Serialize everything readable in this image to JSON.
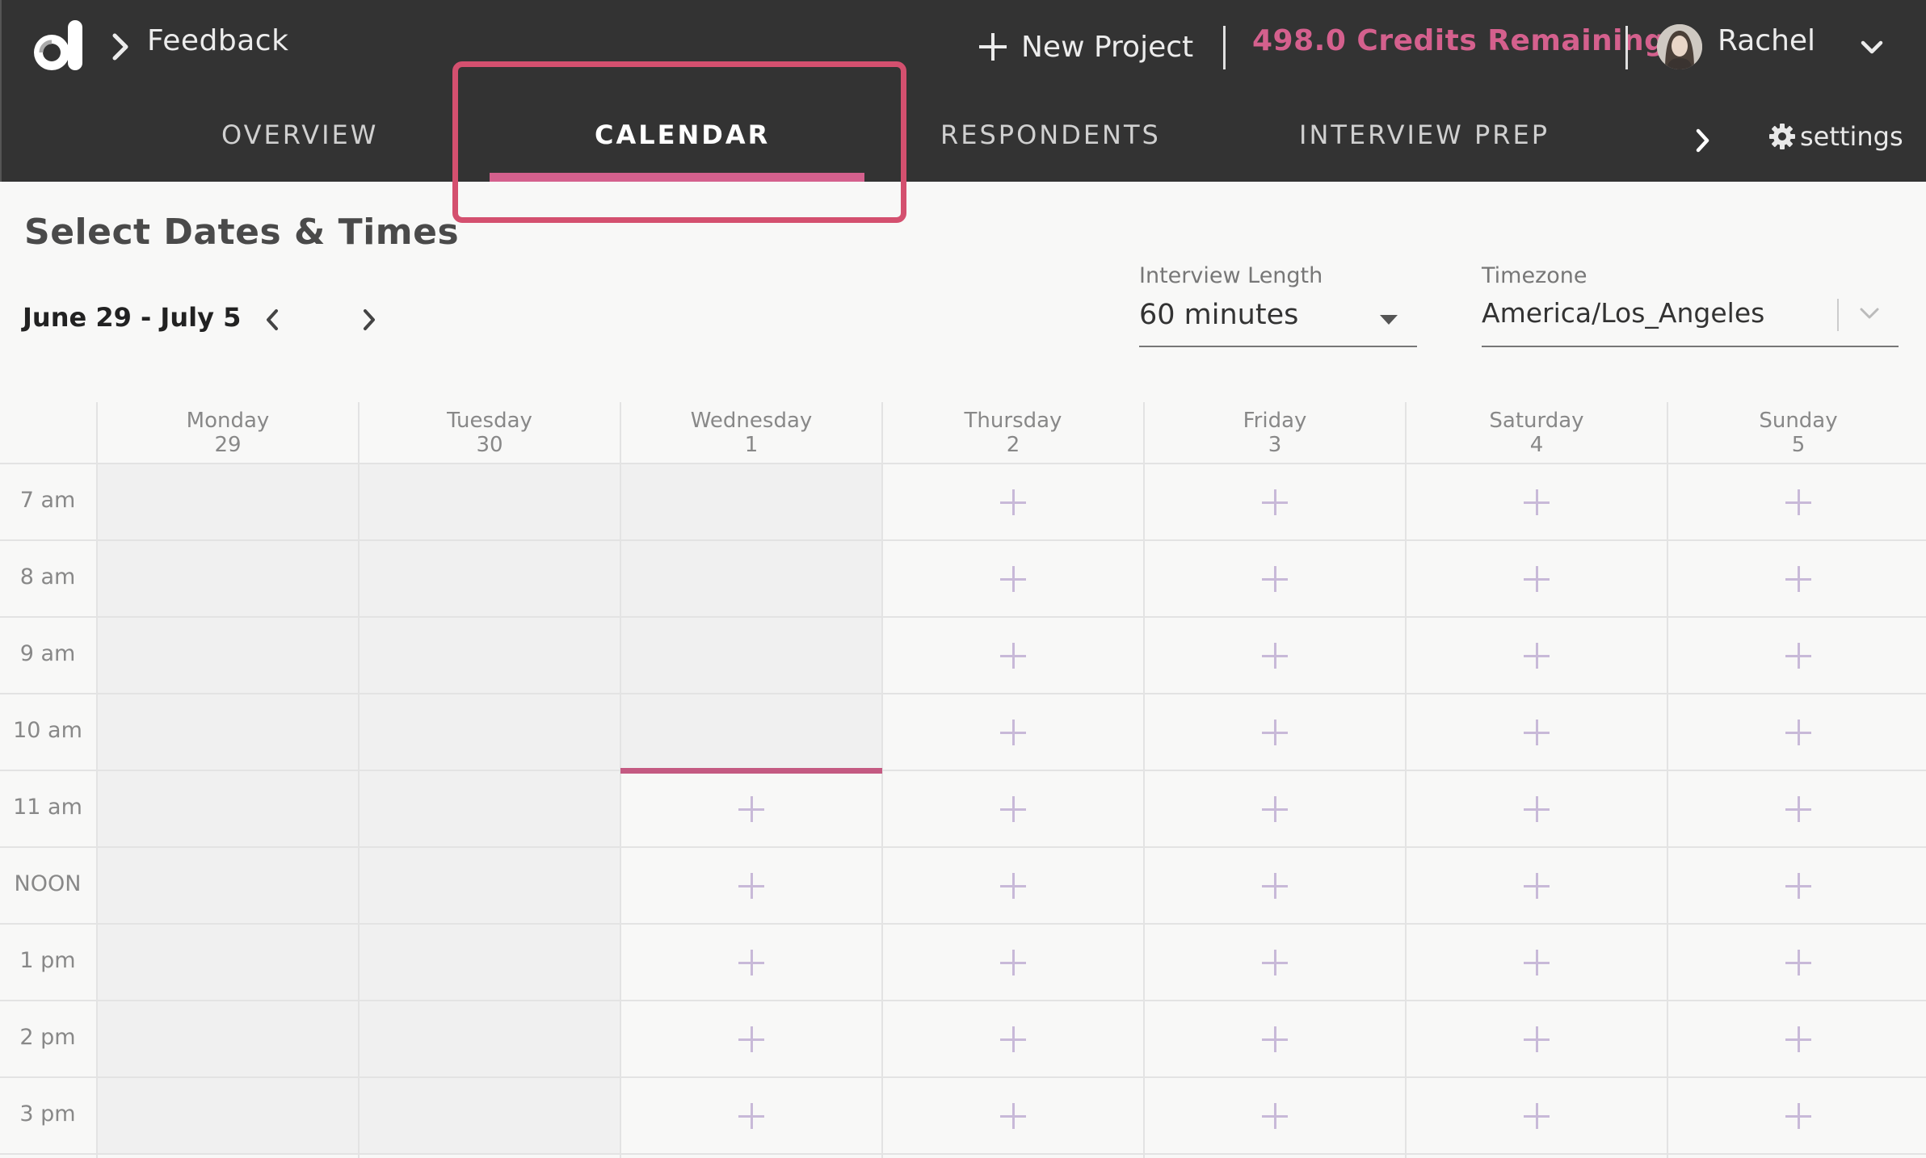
{
  "header": {
    "logo_name": "d-logo",
    "breadcrumb": "Feedback",
    "new_project_label": "New Project",
    "credits_label": "498.0 Credits Remaining",
    "user_name": "Rachel",
    "accent_color": "#d4608d"
  },
  "tabs": [
    {
      "label": "OVERVIEW",
      "active": false
    },
    {
      "label": "CALENDAR",
      "active": true
    },
    {
      "label": "RESPONDENTS",
      "active": false
    },
    {
      "label": "INTERVIEW PREP",
      "active": false
    }
  ],
  "settings_label": "settings",
  "controls": {
    "title": "Select Dates & Times",
    "date_range": "June 29 - July 5",
    "interview_length_label": "Interview Length",
    "interview_length_value": "60 minutes",
    "timezone_label": "Timezone",
    "timezone_value": "America/Los_Angeles"
  },
  "calendar": {
    "days": [
      {
        "name": "Monday",
        "date": "29"
      },
      {
        "name": "Tuesday",
        "date": "30"
      },
      {
        "name": "Wednesday",
        "date": "1"
      },
      {
        "name": "Thursday",
        "date": "2"
      },
      {
        "name": "Friday",
        "date": "3"
      },
      {
        "name": "Saturday",
        "date": "4"
      },
      {
        "name": "Sunday",
        "date": "5"
      }
    ],
    "times": [
      "7 am",
      "8 am",
      "9 am",
      "10 am",
      "11 am",
      "NOON",
      "1 pm",
      "2 pm",
      "3 pm"
    ],
    "past_slots": [
      [
        true,
        true,
        true,
        true,
        true,
        true,
        true,
        true,
        true
      ],
      [
        true,
        true,
        true,
        true,
        true,
        true,
        true,
        true,
        true
      ],
      [
        true,
        true,
        true,
        true,
        false,
        false,
        false,
        false,
        false
      ],
      [
        false,
        false,
        false,
        false,
        false,
        false,
        false,
        false,
        false
      ],
      [
        false,
        false,
        false,
        false,
        false,
        false,
        false,
        false,
        false
      ],
      [
        false,
        false,
        false,
        false,
        false,
        false,
        false,
        false,
        false
      ],
      [
        false,
        false,
        false,
        false,
        false,
        false,
        false,
        false,
        false
      ]
    ],
    "current_time_marker": {
      "day_index": 2,
      "time": "11 am"
    }
  }
}
